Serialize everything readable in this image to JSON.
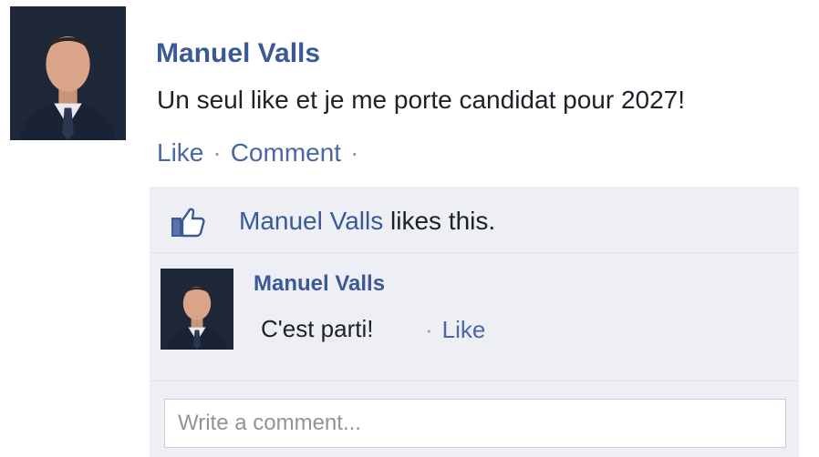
{
  "post": {
    "author": "Manuel Valls",
    "message": "Un seul like et je me porte candidat pour 2027!",
    "actions": {
      "like": "Like",
      "comment": "Comment",
      "separator": "·"
    }
  },
  "likes": {
    "name": "Manuel Valls",
    "suffix": "likes this.",
    "icon": "thumbs-up-icon"
  },
  "comment": {
    "author": "Manuel Valls",
    "text": "C'est parti!",
    "separator": "·",
    "like": "Like"
  },
  "composer": {
    "placeholder": "Write a comment..."
  },
  "colors": {
    "link": "#3b5998",
    "panel": "#edeff5",
    "text": "#1d2129"
  }
}
